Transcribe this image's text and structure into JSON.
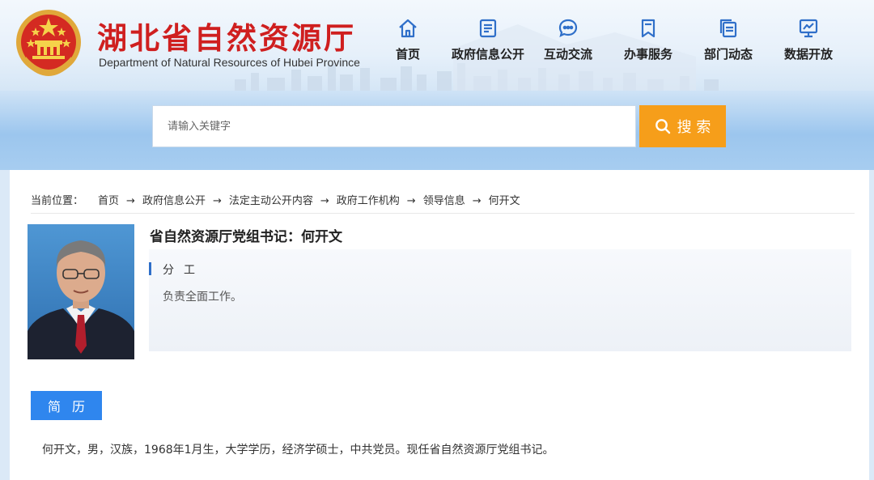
{
  "header": {
    "site_title": "湖北省自然资源厅",
    "site_subtitle": "Department of Natural Resources of Hubei Province",
    "emblem_icon": "national-emblem-icon",
    "nav": [
      {
        "label": "首页",
        "icon": "home-icon"
      },
      {
        "label": "政府信息公开",
        "icon": "document-icon"
      },
      {
        "label": "互动交流",
        "icon": "chat-bubble-icon"
      },
      {
        "label": "办事服务",
        "icon": "bookmark-icon"
      },
      {
        "label": "部门动态",
        "icon": "copy-document-icon"
      },
      {
        "label": "数据开放",
        "icon": "monitor-chart-icon"
      }
    ]
  },
  "search": {
    "placeholder": "请输入关键字",
    "button_label": "搜 索"
  },
  "breadcrumb": {
    "label": "当前位置：",
    "items": [
      "首页",
      "政府信息公开",
      "法定主动公开内容",
      "政府工作机构",
      "领导信息",
      "何开文"
    ],
    "separator": "→"
  },
  "profile": {
    "title": "省自然资源厅党组书记：何开文",
    "duty_heading": "分工",
    "duty_text": "负责全面工作。",
    "resume_button": "简历",
    "resume_text": "何开文，男，汉族，1968年1月生，大学学历，经济学硕士，中共党员。现任省自然资源厅党组书记。"
  },
  "colors": {
    "title_red": "#cf1f1f",
    "nav_icon_blue": "#2f6fc9",
    "search_orange": "#f69e1a",
    "resume_blue": "#2f86ee"
  }
}
